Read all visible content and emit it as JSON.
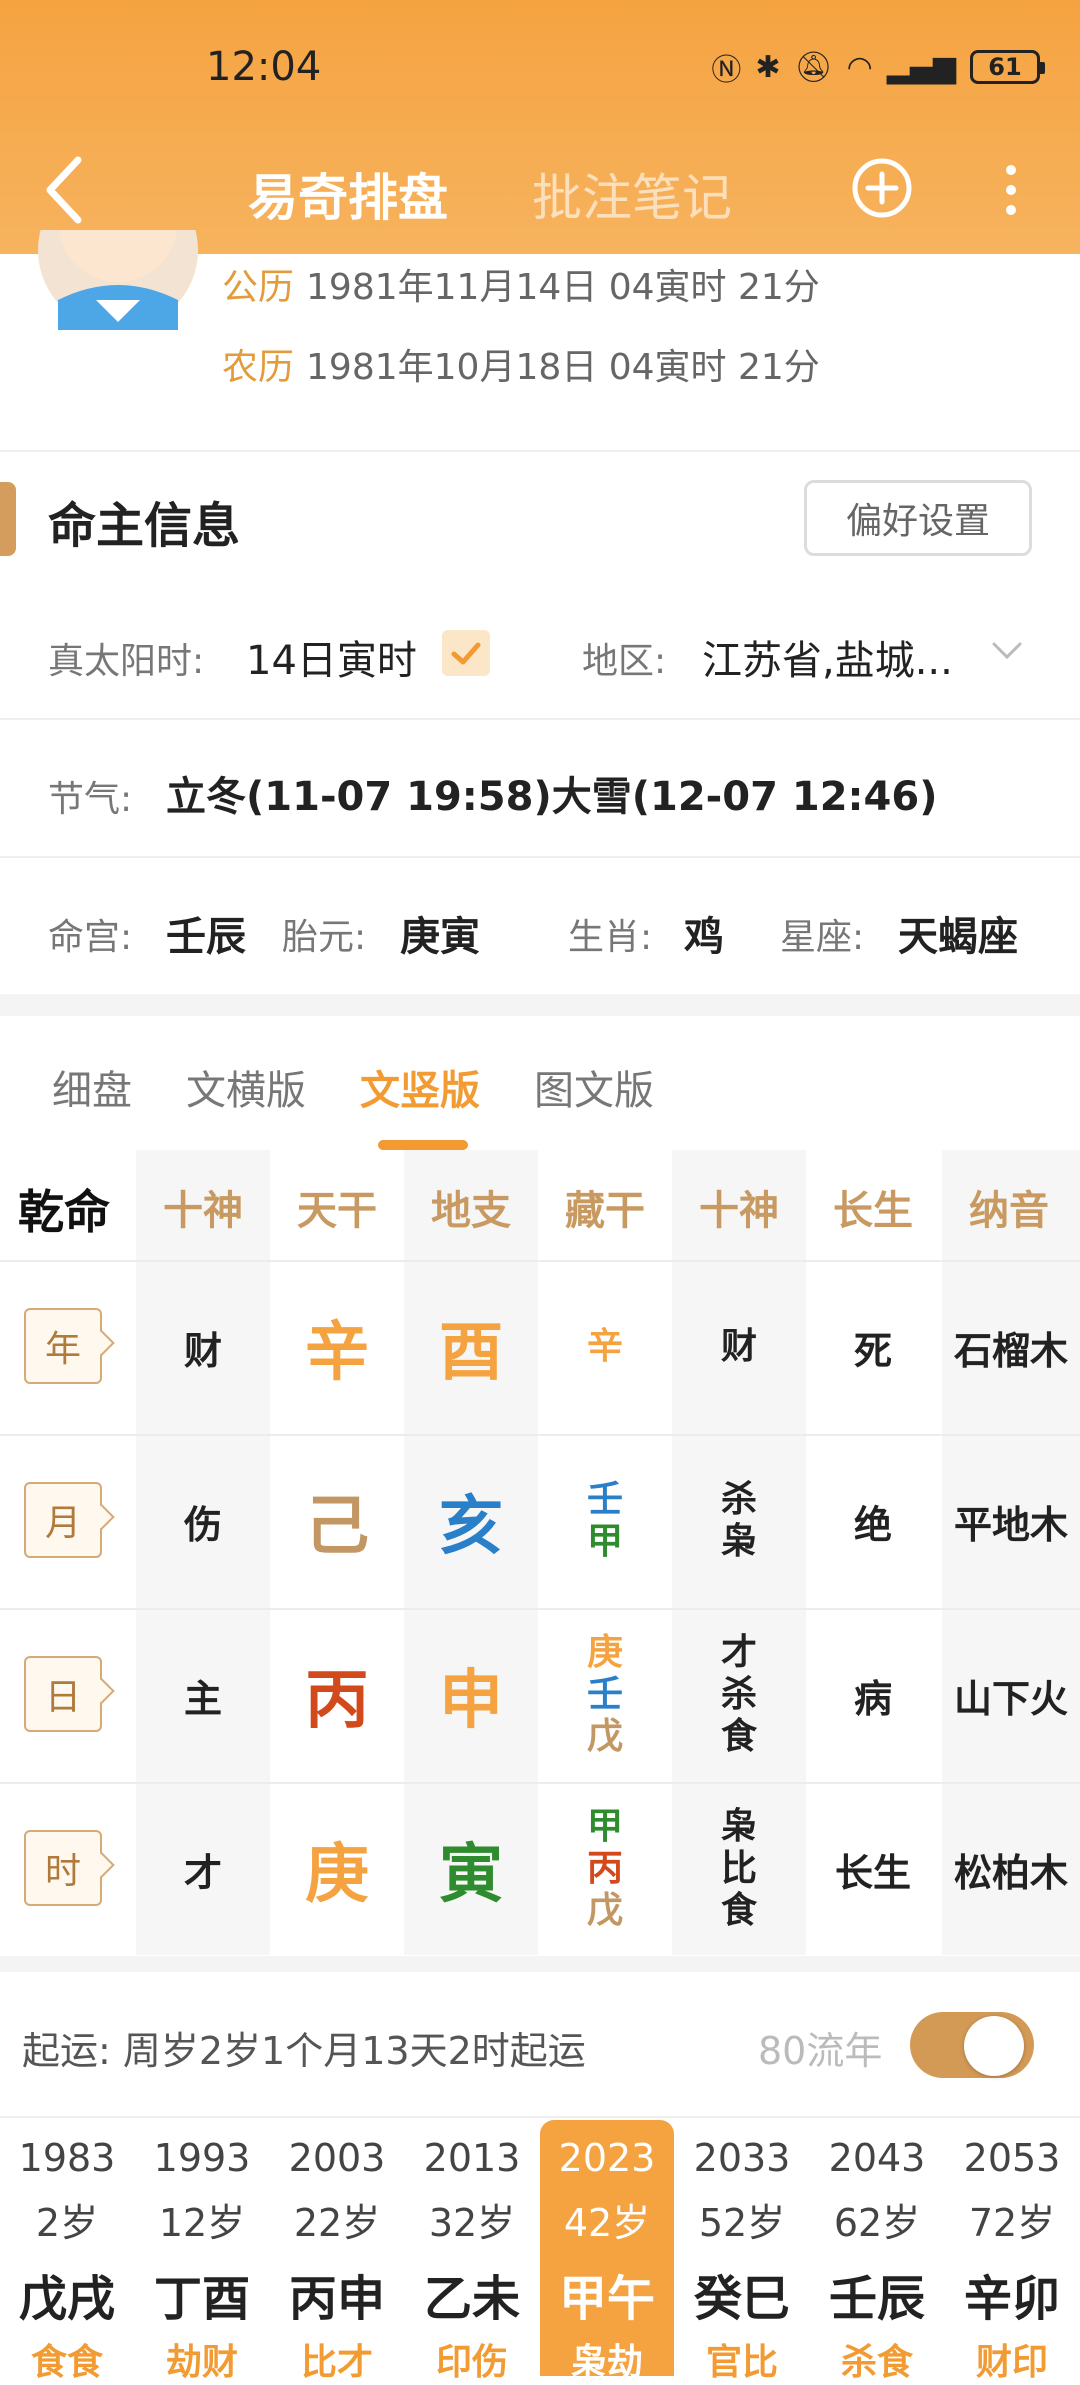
{
  "status": {
    "time": "12:04",
    "battery": "61"
  },
  "header": {
    "tab_main": "易奇排盘",
    "tab_notes": "批注笔记"
  },
  "profile": {
    "solar_key": "公历",
    "solar_value": "1981年11月14日 04寅时 21分",
    "lunar_key": "农历",
    "lunar_value": "1981年10月18日 04寅时 21分"
  },
  "info": {
    "title": "命主信息",
    "pref_button": "偏好设置",
    "true_solar_label": "真太阳时:",
    "true_solar_value": "14日寅时",
    "true_solar_checked": true,
    "region_label": "地区:",
    "region_value": "江苏省,盐城...",
    "jieqi_label": "节气:",
    "jieqi_value": "立冬(11-07 19:58)大雪(12-07 12:46)",
    "minggong_label": "命宫:",
    "minggong_value": "壬辰",
    "taiyuan_label": "胎元:",
    "taiyuan_value": "庚寅",
    "shengxiao_label": "生肖:",
    "shengxiao_value": "鸡",
    "xingzuo_label": "星座:",
    "xingzuo_value": "天蝎座"
  },
  "version_tabs": [
    "细盘",
    "文横版",
    "文竖版",
    "图文版"
  ],
  "version_active": "文竖版",
  "table": {
    "corner": "乾命",
    "headers": [
      "十神",
      "天干",
      "地支",
      "藏干",
      "十神",
      "长生",
      "纳音"
    ],
    "rows": [
      {
        "pillar": "年",
        "shishen": "财",
        "tiangan": "辛",
        "dizhi": "酉",
        "canggan": [
          "辛"
        ],
        "shishen2": [
          "财"
        ],
        "changsheng": "死",
        "nayin": "石榴木"
      },
      {
        "pillar": "月",
        "shishen": "伤",
        "tiangan": "己",
        "dizhi": "亥",
        "canggan": [
          "壬",
          "甲"
        ],
        "shishen2": [
          "杀",
          "枭"
        ],
        "changsheng": "绝",
        "nayin": "平地木"
      },
      {
        "pillar": "日",
        "shishen": "主",
        "tiangan": "丙",
        "dizhi": "申",
        "canggan": [
          "庚",
          "壬",
          "戊"
        ],
        "shishen2": [
          "才",
          "杀",
          "食"
        ],
        "changsheng": "病",
        "nayin": "山下火"
      },
      {
        "pillar": "时",
        "shishen": "才",
        "tiangan": "庚",
        "dizhi": "寅",
        "canggan": [
          "甲",
          "丙",
          "戊"
        ],
        "shishen2": [
          "枭",
          "比",
          "食"
        ],
        "changsheng": "长生",
        "nayin": "松柏木"
      }
    ],
    "colors": {
      "metal": "#f5a341",
      "earth": "#c29763",
      "water": "#2a7fc9",
      "fire": "#d2491c",
      "wood": "#2e8b2e"
    }
  },
  "qiyun": {
    "label": "起运: 周岁2岁1个月13天2时起运",
    "flow_label": "80流年",
    "flow_enabled": true
  },
  "dayun": [
    {
      "year": "1983",
      "age": "2岁",
      "ganzhi": "戊戌",
      "sub": "食食"
    },
    {
      "year": "1993",
      "age": "12岁",
      "ganzhi": "丁酉",
      "sub": "劫财"
    },
    {
      "year": "2003",
      "age": "22岁",
      "ganzhi": "丙申",
      "sub": "比才"
    },
    {
      "year": "2013",
      "age": "32岁",
      "ganzhi": "乙未",
      "sub": "印伤"
    },
    {
      "year": "2023",
      "age": "42岁",
      "ganzhi": "甲午",
      "sub": "枭劫",
      "active": true
    },
    {
      "year": "2033",
      "age": "52岁",
      "ganzhi": "癸巳",
      "sub": "官比"
    },
    {
      "year": "2043",
      "age": "62岁",
      "ganzhi": "壬辰",
      "sub": "杀食"
    },
    {
      "year": "2053",
      "age": "72岁",
      "ganzhi": "辛卯",
      "sub": "财印"
    }
  ]
}
